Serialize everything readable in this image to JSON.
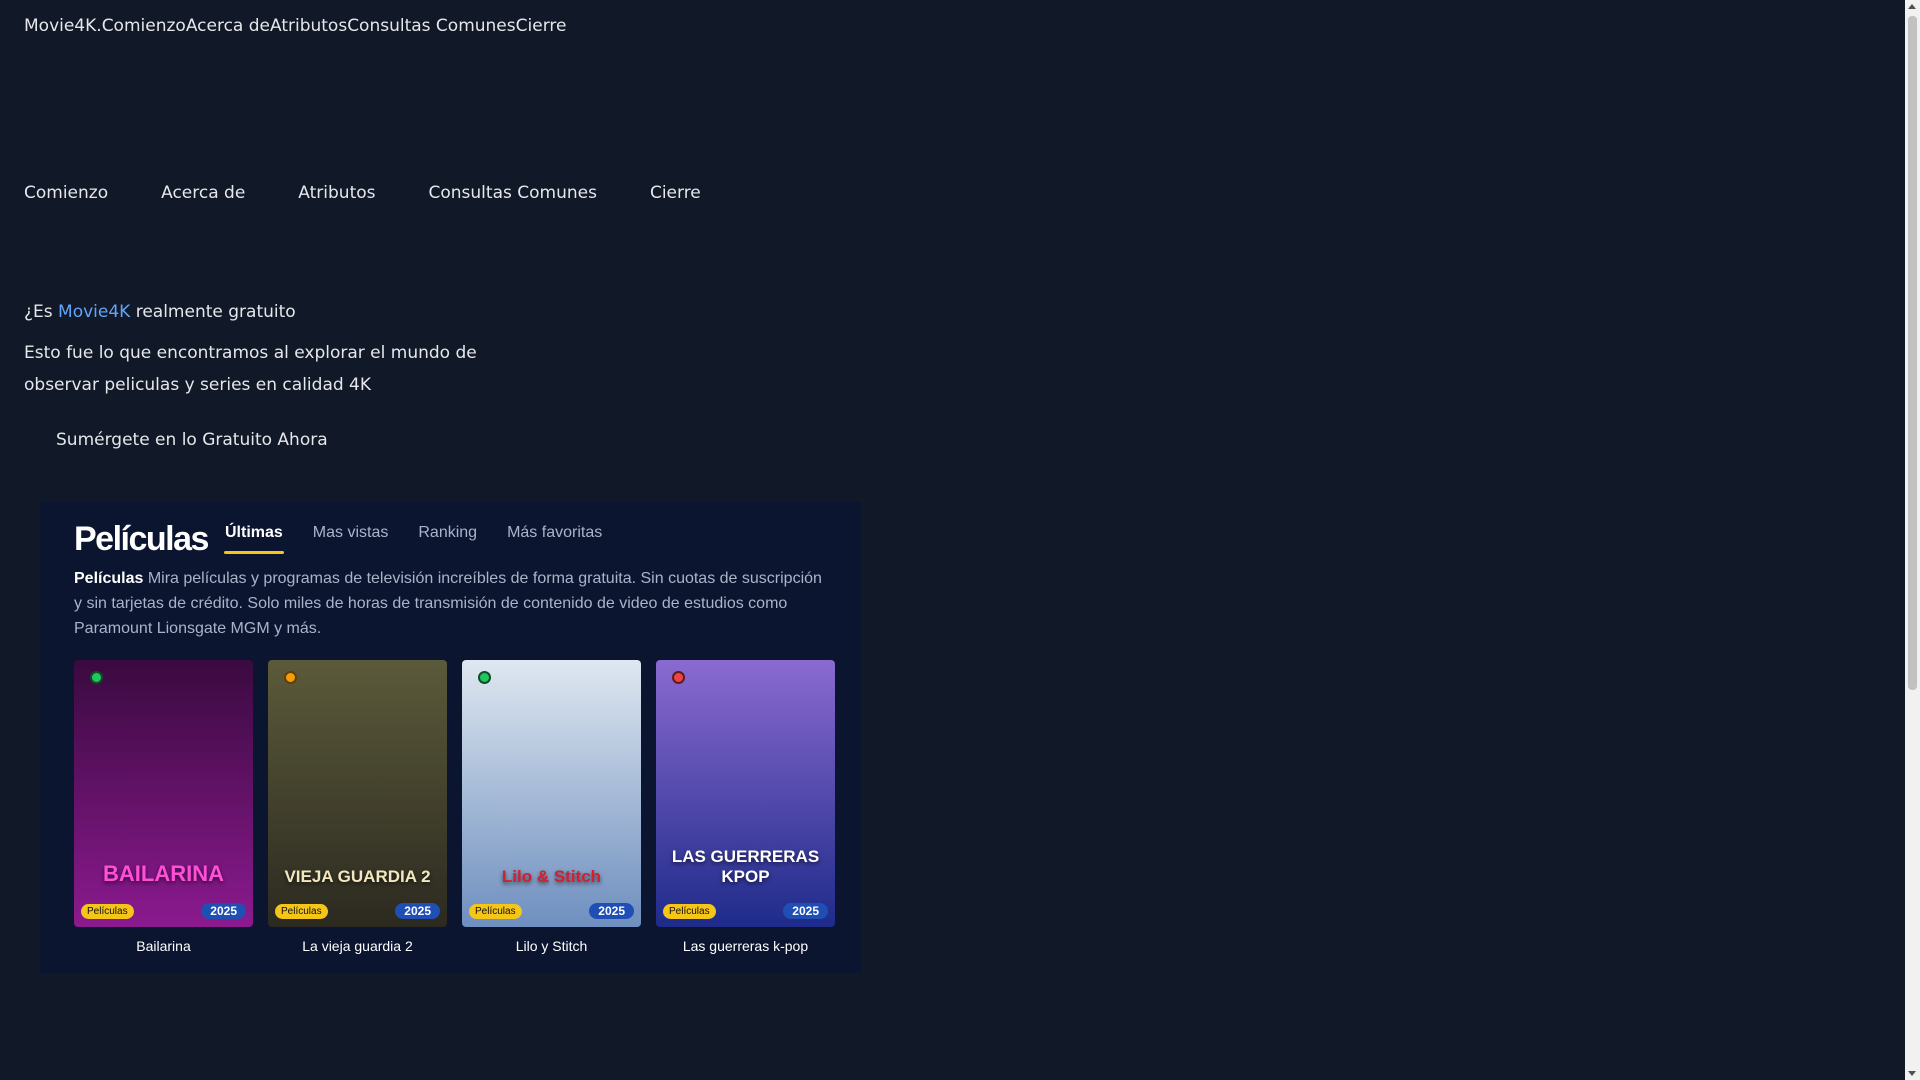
{
  "topbar": {
    "items": [
      "Movie4K.",
      "Comienzo",
      "Acerca de",
      "Atributos",
      "Consultas Comunes",
      "Cierre"
    ]
  },
  "nav": {
    "items": [
      "Comienzo",
      "Acerca de",
      "Atributos",
      "Consultas Comunes",
      "Cierre"
    ]
  },
  "hero": {
    "title_prefix": "¿Es ",
    "title_brand": "Movie4K",
    "title_suffix": " realmente gratuito",
    "description": "Esto fue lo que encontramos al explorar el mundo de observar peliculas y series en calidad 4K",
    "cta": "Sumérgete en lo Gratuito Ahora"
  },
  "widget": {
    "title": "Películas",
    "tabs": [
      "Últimas",
      "Mas vistas",
      "Ranking",
      "Más favoritas"
    ],
    "desc_bold": "Películas",
    "desc": " Mira películas y programas de televisión increíbles de forma gratuita. Sin cuotas de suscripción y sin tarjetas de crédito. Solo miles de horas de transmisión de contenido de video de estudios como Paramount Lionsgate MGM y más.",
    "cards": [
      {
        "title": "Bailarina",
        "poster_text": "BAILARINA",
        "badge_type": "Películas",
        "year": "2025",
        "dot_color": "#22c55e",
        "bg": [
          "#3a0a3f",
          "#8b1a8f"
        ],
        "text_color": "#ff4fd8"
      },
      {
        "title": "La vieja guardia 2",
        "poster_text": "VIEJA GUARDIA 2",
        "badge_type": "Películas",
        "year": "2025",
        "dot_color": "#f59e0b",
        "bg": [
          "#5b5a3a",
          "#2c2a20"
        ],
        "text_color": "#f3e7c0"
      },
      {
        "title": "Lilo y Stitch",
        "poster_text": "Lilo & Stitch",
        "badge_type": "Películas",
        "year": "2025",
        "dot_color": "#22c55e",
        "bg": [
          "#dfe7f0",
          "#6e8fbf"
        ],
        "text_color": "#d51f2b"
      },
      {
        "title": "Las guerreras k-pop",
        "poster_text": "LAS GUERRERAS KPOP",
        "badge_type": "Películas",
        "year": "2025",
        "dot_color": "#ef4444",
        "bg": [
          "#8a6ad0",
          "#1e2b8a"
        ],
        "text_color": "#ffffff"
      }
    ]
  }
}
